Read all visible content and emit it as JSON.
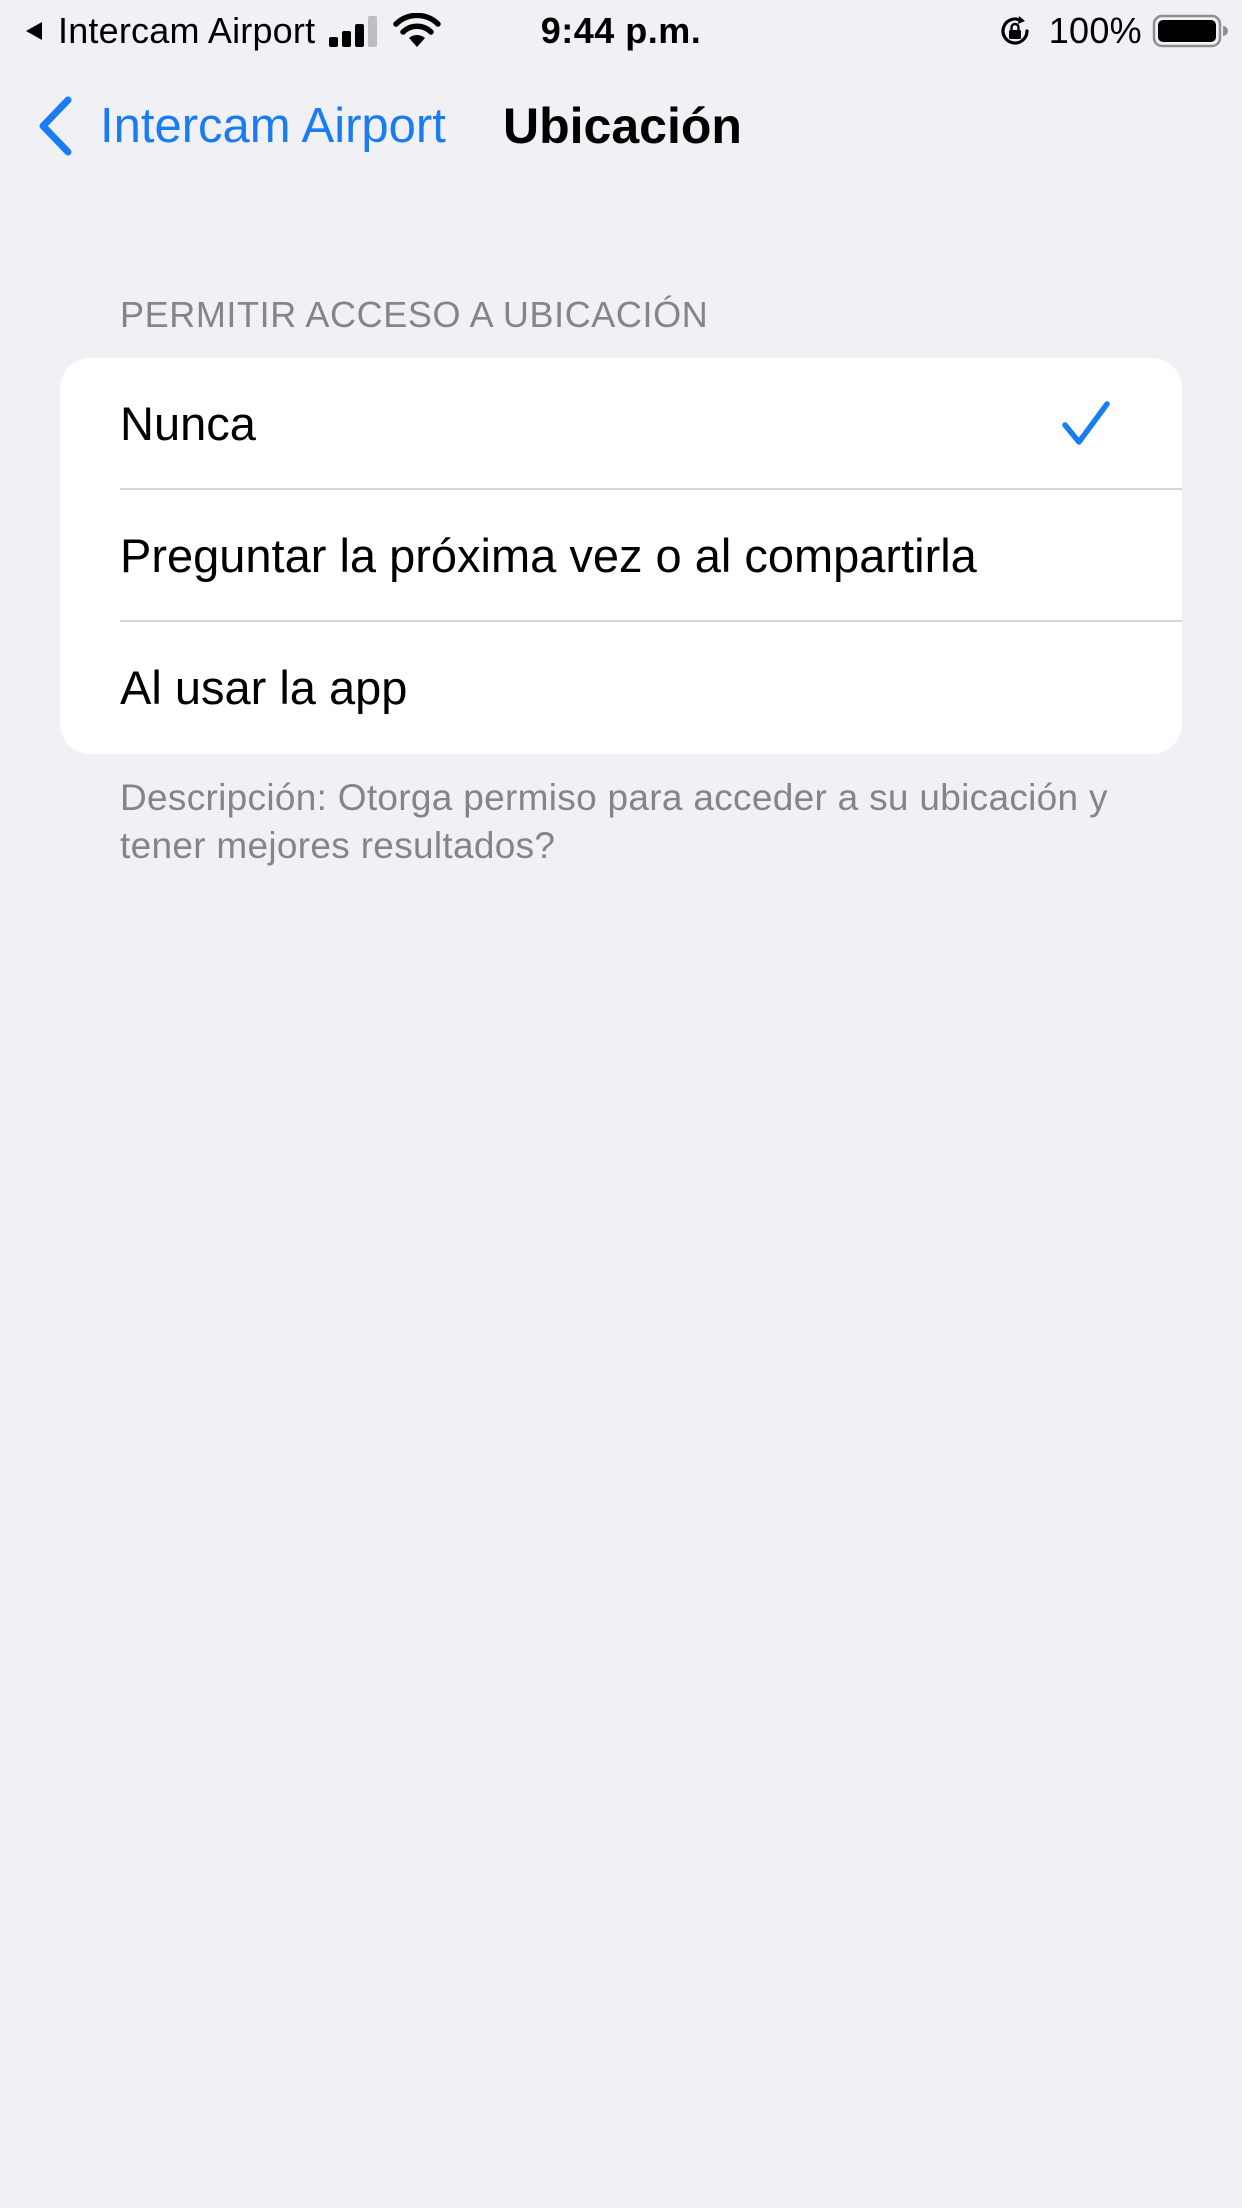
{
  "status_bar": {
    "carrier": "Intercam Airport",
    "time": "9:44 p.m.",
    "battery_percent": "100%",
    "signal_bars": 3,
    "battery_level": 1.0,
    "icons": [
      "back-to-app-arrow-icon",
      "signal-icon",
      "wifi-icon",
      "rotation-lock-icon",
      "battery-icon"
    ]
  },
  "nav": {
    "back_label": "Intercam Airport",
    "title": "Ubicación",
    "back_icon": "chevron-left-icon"
  },
  "section": {
    "header": "PERMITIR ACCESO A UBICACIÓN",
    "options": [
      {
        "label": "Nunca",
        "selected": true
      },
      {
        "label": "Preguntar la próxima vez o al compartirla",
        "selected": false
      },
      {
        "label": "Al usar la app",
        "selected": false
      }
    ],
    "footer": "Descripción: Otorga permiso para acceder a su ubicación y tener mejores resultados?"
  },
  "colors": {
    "accent": "#1A7CF5",
    "background": "#F0F0F5",
    "card": "#FFFFFF",
    "secondary_text": "#84848A",
    "separator": "#D8D8DC"
  }
}
